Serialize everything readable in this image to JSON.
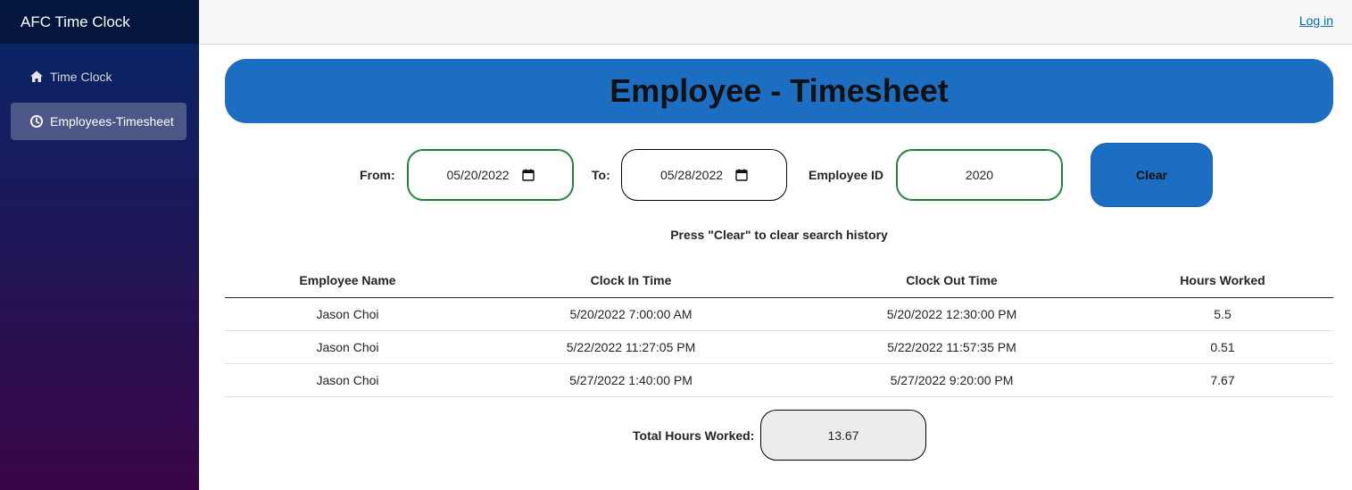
{
  "app": {
    "title": "AFC Time Clock"
  },
  "sidebar": {
    "items": [
      {
        "label": "Time Clock",
        "icon": "home-icon",
        "active": false
      },
      {
        "label": "Employees-Timesheet",
        "icon": "clock-icon",
        "active": true
      }
    ]
  },
  "topbar": {
    "login_label": "Log in"
  },
  "page": {
    "title": "Employee - Timesheet"
  },
  "filters": {
    "from_label": "From:",
    "from_value": "05/20/2022",
    "to_label": "To:",
    "to_value": "05/28/2022",
    "employee_id_label": "Employee ID",
    "employee_id_value": "2020",
    "clear_label": "Clear"
  },
  "hint": "Press \"Clear\" to clear search history",
  "table": {
    "headers": [
      "Employee Name",
      "Clock In Time",
      "Clock Out Time",
      "Hours Worked"
    ],
    "rows": [
      [
        "Jason Choi",
        "5/20/2022 7:00:00 AM",
        "5/20/2022 12:30:00 PM",
        "5.5"
      ],
      [
        "Jason Choi",
        "5/22/2022 11:27:05 PM",
        "5/22/2022 11:57:35 PM",
        "0.51"
      ],
      [
        "Jason Choi",
        "5/27/2022 1:40:00 PM",
        "5/27/2022 9:20:00 PM",
        "7.67"
      ]
    ]
  },
  "total": {
    "label": "Total Hours Worked:",
    "value": "13.67"
  },
  "colors": {
    "accent": "#1b6ec2",
    "sidebar_top": "#052767",
    "sidebar_bottom": "#3a0647",
    "link": "#006bb7"
  }
}
